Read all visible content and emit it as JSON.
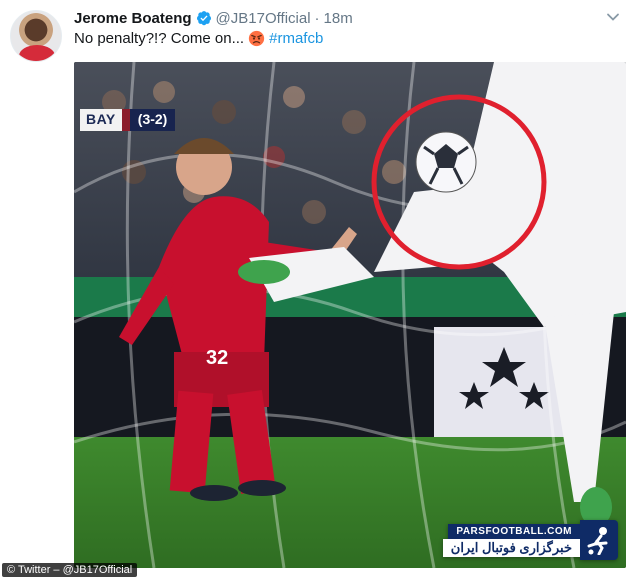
{
  "tweet": {
    "display_name": "Jerome Boateng",
    "handle": "@JB17Official",
    "separator": "·",
    "timestamp": "18m",
    "text_before": "No penalty?!? Come on...",
    "hashtag": "#rmafcb"
  },
  "media": {
    "score_team": "BAY",
    "score_value": "(3-2)",
    "watermark_top": "PARSFOOTBALL.COM",
    "watermark_bottom": "خبرگزاری فوتبال ایران"
  },
  "credit": "© Twitter – @JB17Official",
  "icons": {
    "verified": "verified-badge-icon",
    "angry_emoji": "angry-face-emoji-icon",
    "chevron": "chevron-down-icon"
  },
  "colors": {
    "verified": "#1da1f2",
    "hashtag": "#1b95e0",
    "highlight_circle": "#e0202e",
    "bayern_red": "#c8102e"
  }
}
